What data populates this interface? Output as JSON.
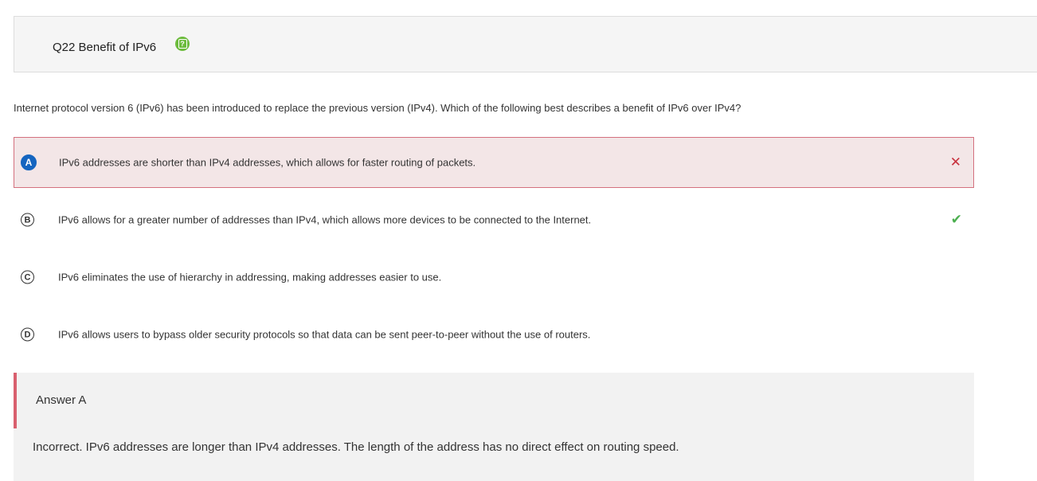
{
  "question": {
    "title": "Q22 Benefit of IPv6",
    "help_icon": "help-icon",
    "text": "Internet protocol version 6 (IPv6) has been introduced to replace the previous version (IPv4). Which of the following best describes a benefit of IPv6 over IPv4?"
  },
  "options": [
    {
      "letter": "A",
      "text": "IPv6 addresses are shorter than IPv4 addresses, which allows for faster routing of packets.",
      "status": "selected-incorrect",
      "mark": "✕"
    },
    {
      "letter": "B",
      "text": "IPv6 allows for a greater number of addresses than IPv4, which allows more devices to be connected to the Internet.",
      "status": "correct",
      "mark": "✔"
    },
    {
      "letter": "C",
      "text": "IPv6 eliminates the use of hierarchy in addressing, making addresses easier to use.",
      "status": "none",
      "mark": ""
    },
    {
      "letter": "D",
      "text": "IPv6 allows users to bypass older security protocols so that data can be sent peer-to-peer without the use of routers.",
      "status": "none",
      "mark": ""
    }
  ],
  "answer": {
    "title": "Answer A",
    "explanation": "Incorrect. IPv6 addresses are longer than IPv4 addresses. The length of the address has no direct effect on routing speed."
  },
  "colors": {
    "selected_wrong_bg": "#f3e6e7",
    "selected_wrong_border": "#d4707e",
    "selected_letter_bg": "#1565c0",
    "wrong_mark": "#c8323e",
    "correct_mark": "#4caf50",
    "help_icon": "#6cbb3c",
    "answer_stripe": "#d9606f"
  }
}
